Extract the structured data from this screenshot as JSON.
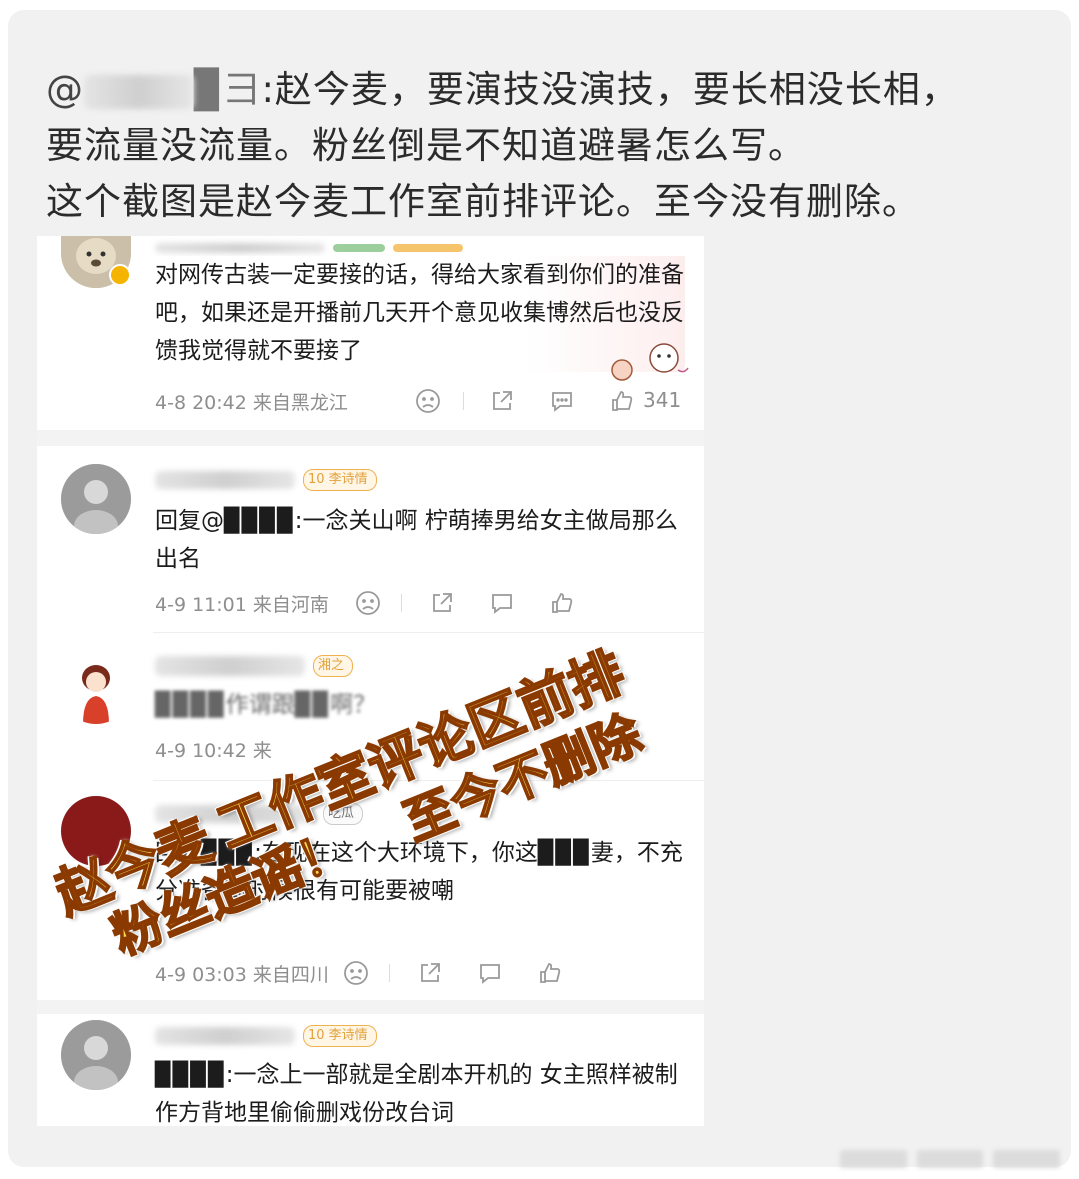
{
  "post": {
    "mention_prefix": "@",
    "mention_visible": "▉彐",
    "line1_text": ":赵今麦，要演技没演技，要长相没长相，",
    "line2": "要流量没流量。粉丝倒是不知道避暑怎么写。",
    "line3": "这个截图是赵今麦工作室前排评论。至今没有删除。"
  },
  "comments": [
    {
      "text": "对网传古装一定要接的话，得给大家看到你们的准备吧，如果还是开播前几天开个意见收集博然后也没反馈我觉得就不要接了",
      "date": "4-8 20:42 来自黑龙江",
      "likes": "341"
    },
    {
      "badge": "10 李诗情",
      "text": "回复@▉▉▉▉:一念关山啊 柠萌捧男给女主做局那么出名",
      "date": "4-9 11:01 来自河南"
    },
    {
      "badge": "湘之",
      "text": "▉▉▉▉作谓跟▉▉啊？",
      "date": "4-9 10:42 来"
    },
    {
      "badge": "吃瓜",
      "text": "回复▉▉▉:在现在这个大环境下，你这▉▉▉妻，不充分准备到时候很有可能要被嘲",
      "date": "4-9 03:03 来自四川"
    },
    {
      "badge": "10 李诗情",
      "text": "▉▉▉▉:一念上一部就是全剧本开机的 女主照样被制作方背地里偷偷删戏份改台词"
    }
  ],
  "overlay": {
    "line1": "工作室评论区前排",
    "line1_prefix": "赵今麦",
    "line2": "粉丝造谣！",
    "line2_suffix": "至今不删除"
  },
  "colors": {
    "card_bg": "#f1f1f1",
    "overlay_text": "#ffd84a",
    "overlay_stroke": "#8a3a00",
    "badge": "#f0b24f"
  }
}
